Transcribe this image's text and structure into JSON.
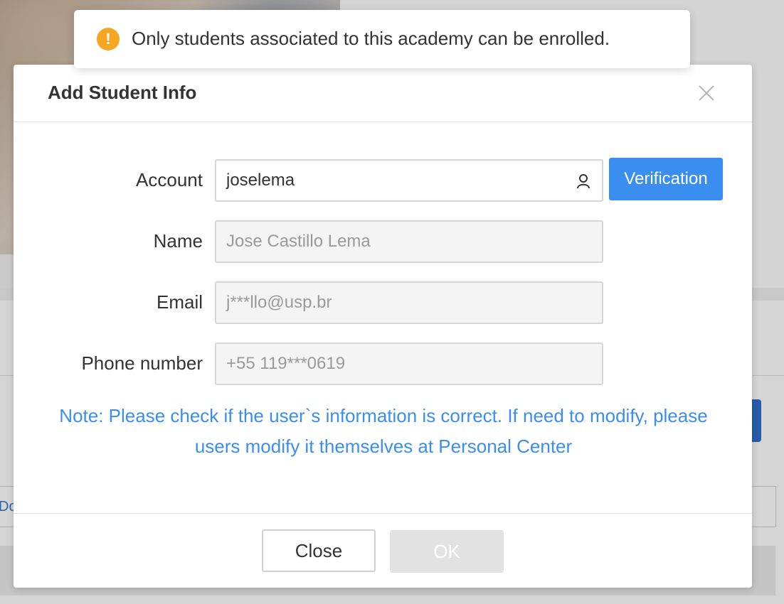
{
  "toast": {
    "message": "Only students associated to this academy can be enrolled.",
    "icon": "warning-icon",
    "icon_glyph": "!",
    "icon_color": "#f5a623"
  },
  "modal": {
    "title": "Add Student Info",
    "close_icon": "close-icon"
  },
  "form": {
    "account": {
      "label": "Account",
      "value": "joselema",
      "icon": "user-icon"
    },
    "verification_label": "Verification",
    "name": {
      "label": "Name",
      "value": "Jose Castillo Lema"
    },
    "email": {
      "label": "Email",
      "value": "j***llo@usp.br"
    },
    "phone": {
      "label": "Phone number",
      "value": "+55 119***0619"
    }
  },
  "note": "Note: Please check if the user`s information is correct. If need to modify, please users modify it themselves at Personal Center",
  "footer": {
    "close_label": "Close",
    "ok_label": "OK"
  },
  "background": {
    "link_text": "Do"
  },
  "colors": {
    "accent": "#3a8ef0",
    "warning": "#f5a623",
    "disabled": "#e2e2e2"
  }
}
